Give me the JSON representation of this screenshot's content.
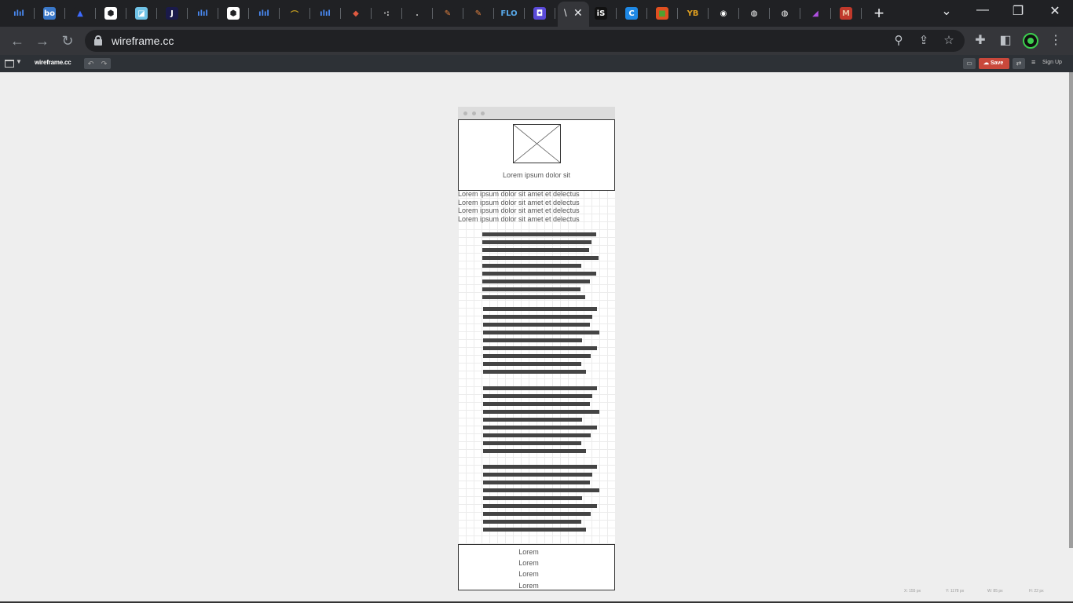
{
  "browser": {
    "active_tab_label": "\\",
    "url": "wireframe.cc",
    "new_tab_label": "+",
    "colors": {
      "tabbar": "#202124",
      "toolbar": "#35363a"
    },
    "tab_favicons": [
      {
        "text": "ılıl",
        "bg": "#202124",
        "fg": "#4a8af4"
      },
      {
        "text": "bo",
        "bg": "#3a78c9",
        "fg": "#ffffff"
      },
      {
        "text": "▲",
        "bg": "#202124",
        "fg": "#3d6bff"
      },
      {
        "text": "⬢",
        "bg": "#ffffff",
        "fg": "#202124"
      },
      {
        "text": "◪",
        "bg": "#6fc2e6",
        "fg": "#ffffff"
      },
      {
        "text": "J",
        "bg": "#1a1a4a",
        "fg": "#ffffff"
      },
      {
        "text": "ılıl",
        "bg": "#202124",
        "fg": "#4a8af4"
      },
      {
        "text": "⬢",
        "bg": "#ffffff",
        "fg": "#202124"
      },
      {
        "text": "ılıl",
        "bg": "#202124",
        "fg": "#4a8af4"
      },
      {
        "text": "⌒",
        "bg": "#202124",
        "fg": "#c8a020"
      },
      {
        "text": "ılıl",
        "bg": "#202124",
        "fg": "#4a8af4"
      },
      {
        "text": "◆",
        "bg": "#202124",
        "fg": "#e05a40"
      },
      {
        "text": "·:",
        "bg": "#202124",
        "fg": "#bbbbbb"
      },
      {
        "text": ".",
        "bg": "#202124",
        "fg": "#bbbbbb"
      },
      {
        "text": "✎",
        "bg": "#202124",
        "fg": "#e08040"
      },
      {
        "text": "✎",
        "bg": "#202124",
        "fg": "#e08040"
      },
      {
        "text": "FLO",
        "bg": "#202124",
        "fg": "#58a8e8"
      },
      {
        "text": "◘",
        "bg": "#5a4ad8",
        "fg": "#ffffff"
      }
    ],
    "tab_favicons_right": [
      {
        "text": "iS",
        "bg": "#111111",
        "fg": "#ffffff"
      },
      {
        "text": "C",
        "bg": "#1e88e5",
        "fg": "#ffffff"
      },
      {
        "text": "■",
        "bg": "#e05020",
        "fg": "#50a030"
      },
      {
        "text": "YB",
        "bg": "#202124",
        "fg": "#e0a020"
      },
      {
        "text": "◉",
        "bg": "#202124",
        "fg": "#ffffff"
      },
      {
        "text": "◍",
        "bg": "#202124",
        "fg": "#ffffff"
      },
      {
        "text": "◍",
        "bg": "#202124",
        "fg": "#ffffff"
      },
      {
        "text": "◢",
        "bg": "#202124",
        "fg": "#b050e0"
      },
      {
        "text": "M",
        "bg": "#c0392b",
        "fg": "#e8c0a0"
      }
    ]
  },
  "app": {
    "logo": "wireframe.cc",
    "undo_label": "↶",
    "redo_label": "↷",
    "comment_label": "▭",
    "save_label": "Save",
    "settings_label": "⇄",
    "menu_label": "≡",
    "signup_label": "Sign Up",
    "save_color": "#c9483b"
  },
  "wireframe": {
    "header_caption": "Lorem ipsum dolor sit",
    "paragraph_lines": [
      "Lorem ipsum dolor sit amet et delectus",
      "Lorem ipsum dolor sit amet et delectus",
      "Lorem ipsum dolor sit amet et delectus",
      "Lorem ipsum dolor sit amet et delectus"
    ],
    "footer_items": [
      "Lorem",
      "Lorem",
      "Lorem",
      "Lorem"
    ]
  },
  "status": {
    "x": "X: 155 px",
    "y": "Y: 1178 px",
    "w": "W: 85 px",
    "h": "H: 22 px"
  }
}
